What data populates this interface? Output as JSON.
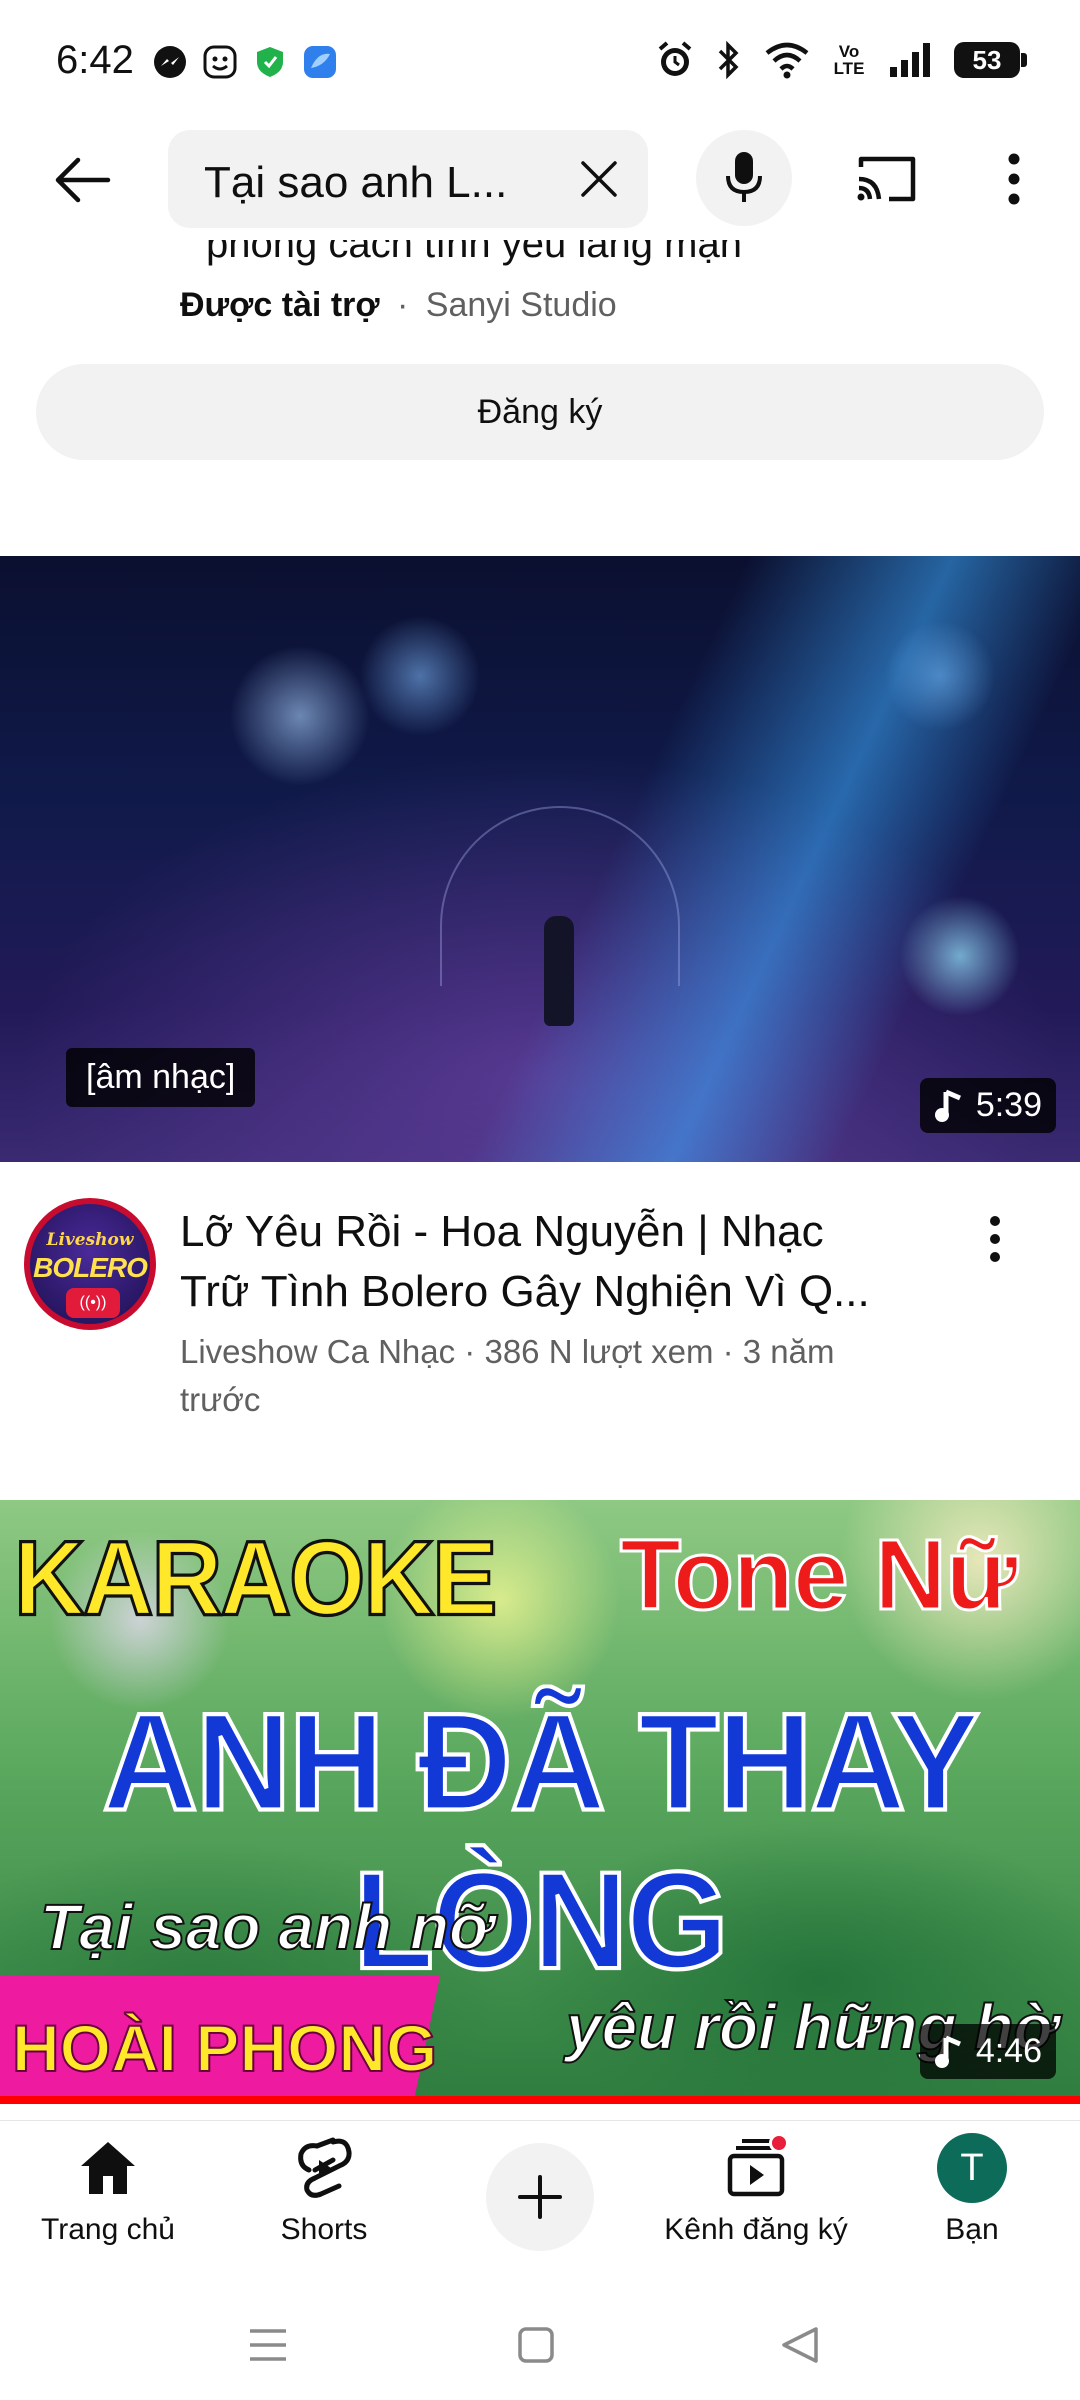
{
  "status_bar": {
    "time": "6:42",
    "battery": "53",
    "network_label": "Vo LTE",
    "app_icons": [
      "messenger-icon",
      "face-app-icon",
      "shield-vpn-icon",
      "bird-app-icon"
    ],
    "system_icons": [
      "alarm-icon",
      "bluetooth-icon",
      "wifi-icon",
      "signal-icon",
      "battery-icon"
    ]
  },
  "header": {
    "search_query": "Tại sao anh L...",
    "icons": [
      "back-arrow-icon",
      "clear-icon",
      "mic-icon",
      "cast-icon",
      "more-vertical-icon"
    ]
  },
  "ad": {
    "clipped_title": "phong cách tình yêu lãng mạn",
    "sponsored_label": "Được tài trợ",
    "separator": "·",
    "advertiser": "Sanyi Studio",
    "subscribe_label": "Đăng ký"
  },
  "video1": {
    "caption": "[âm nhạc]",
    "duration": "5:39",
    "title_line1": "Lỡ Yêu Rồi - Hoa Nguyễn | Nhạc",
    "title_line2": "Trữ Tình Bolero Gây Nghiện Vì Q...",
    "meta_line1": "Liveshow Ca Nhạc · 386 N lượt xem · 3 năm",
    "meta_line2": "trước",
    "channel_avatar": {
      "top_text": "Liveshow",
      "main_text": "BOLERO",
      "badge": "((•))"
    }
  },
  "video2": {
    "karaoke_text": "KARAOKE",
    "tone_text": "Tone Nữ",
    "main_title": "ANH ĐÃ THAY LÒNG",
    "lyric_line1": "Tại sao anh nỡ",
    "lyric_line2": "yêu rồi hững hờ",
    "singer": "HOÀI PHONG",
    "duration": "4:46"
  },
  "bottom_nav": {
    "items": [
      {
        "label": "Trang chủ",
        "icon": "home-icon"
      },
      {
        "label": "Shorts",
        "icon": "shorts-icon"
      },
      {
        "label": "",
        "icon": "create-plus-icon"
      },
      {
        "label": "Kênh đăng ký",
        "icon": "subscriptions-icon"
      },
      {
        "label": "Bạn",
        "icon": "profile-avatar"
      }
    ],
    "profile_initial": "T"
  },
  "colors": {
    "brand_red": "#ff0000",
    "avatar_green": "#0d6b59",
    "notif_red": "#e91e3a"
  }
}
